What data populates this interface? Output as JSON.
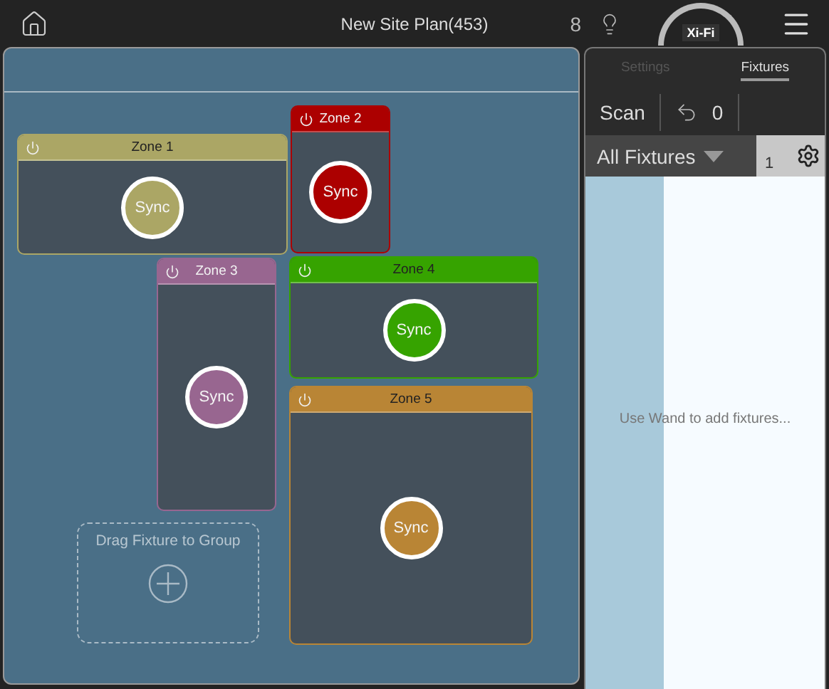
{
  "top_bar": {
    "title": "New Site Plan(453)",
    "count": "8",
    "badge": "Xi-Fi"
  },
  "zones": [
    {
      "name": "Zone 1",
      "color": "#aba665",
      "title_dark": true,
      "button": "Sync"
    },
    {
      "name": "Zone 2",
      "color": "#ac0000",
      "title_dark": false,
      "button": "Sync"
    },
    {
      "name": "Zone 3",
      "color": "#986690",
      "title_dark": false,
      "button": "Sync"
    },
    {
      "name": "Zone 4",
      "color": "#36a300",
      "title_dark": true,
      "button": "Sync"
    },
    {
      "name": "Zone 5",
      "color": "#b98535",
      "title_dark": true,
      "button": "Sync"
    }
  ],
  "drop_target": {
    "label": "Drag Fixture to Group"
  },
  "side_panel": {
    "tabs": [
      {
        "label": "Settings",
        "selected": false
      },
      {
        "label": "Fixtures",
        "selected": true
      }
    ],
    "scan": "Scan",
    "undo_count": "0",
    "filter": "All Fixtures",
    "filter_count": "1",
    "empty_message": "Use Wand to add fixtures..."
  }
}
